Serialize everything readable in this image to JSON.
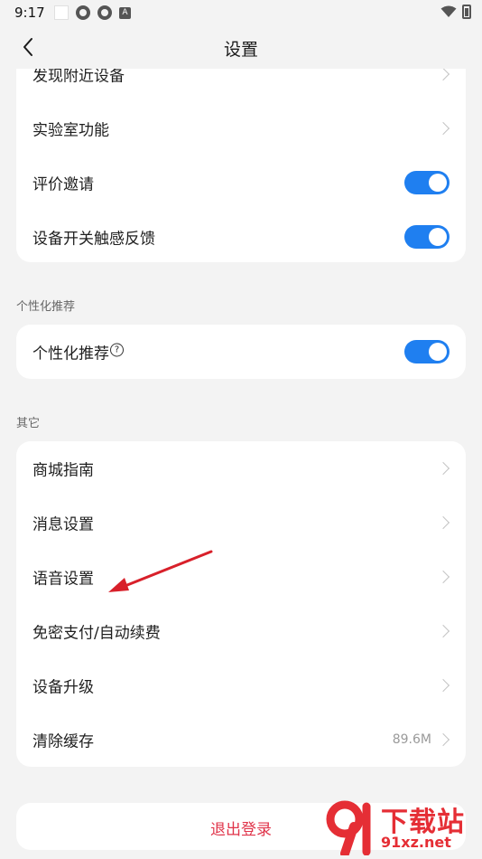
{
  "status": {
    "time": "9:17"
  },
  "header": {
    "title": "设置"
  },
  "group1": {
    "items": [
      {
        "label": "发现附近设备",
        "control": "chevron"
      },
      {
        "label": "实验室功能",
        "control": "chevron"
      },
      {
        "label": "评价邀请",
        "control": "toggle",
        "on": true
      },
      {
        "label": "设备开关触感反馈",
        "control": "toggle",
        "on": true
      }
    ]
  },
  "section_personalize": {
    "title": "个性化推荐",
    "item": {
      "label": "个性化推荐",
      "help_icon": "question-circle-icon",
      "control": "toggle",
      "on": true
    }
  },
  "section_other": {
    "title": "其它",
    "items": [
      {
        "label": "商城指南",
        "control": "chevron"
      },
      {
        "label": "消息设置",
        "control": "chevron"
      },
      {
        "label": "语音设置",
        "control": "chevron"
      },
      {
        "label": "免密支付/自动续费",
        "control": "chevron"
      },
      {
        "label": "设备升级",
        "control": "chevron"
      },
      {
        "label": "清除缓存",
        "value": "89.6M",
        "control": "chevron"
      }
    ]
  },
  "logout": {
    "label": "退出登录"
  },
  "watermark": {
    "text": "下载站",
    "url": "91xz.net"
  },
  "colors": {
    "accent": "#1f7ff0",
    "danger": "#e0344a",
    "annotation": "#d8202a"
  }
}
